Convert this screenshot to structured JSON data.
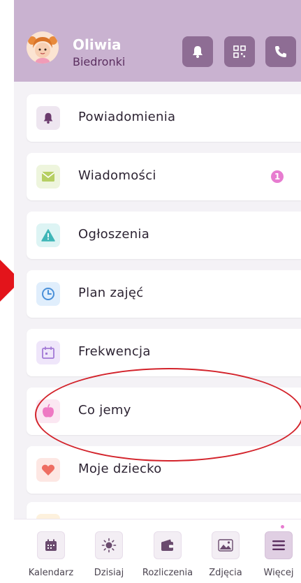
{
  "header": {
    "name": "Oliwia",
    "group": "Biedronki"
  },
  "menu": {
    "items": [
      {
        "label": "Powiadomienia",
        "icon": "bell-icon",
        "bg": "#eee6f0",
        "fg": "#6b3b6d"
      },
      {
        "label": "Wiadomości",
        "icon": "envelope-icon",
        "bg": "#eef5dd",
        "fg": "#b6cf63",
        "badge": "1"
      },
      {
        "label": "Ogłoszenia",
        "icon": "warning-icon",
        "bg": "#ddf4f4",
        "fg": "#3fb6b7"
      },
      {
        "label": "Plan zajęć",
        "icon": "clock-icon",
        "bg": "#e0eefc",
        "fg": "#4a90d9"
      },
      {
        "label": "Frekwencja",
        "icon": "calendar-icon",
        "bg": "#efe6fa",
        "fg": "#a27ad6"
      },
      {
        "label": "Co jemy",
        "icon": "apple-icon",
        "bg": "#fbe7f2",
        "fg": "#ee79c3"
      },
      {
        "label": "Moje dziecko",
        "icon": "heart-icon",
        "bg": "#fde7e3",
        "fg": "#ee6e62"
      }
    ]
  },
  "tabbar": {
    "tabs": [
      {
        "label": "Kalendarz",
        "icon": "calendar-grid-icon"
      },
      {
        "label": "Dzisiaj",
        "icon": "sun-icon"
      },
      {
        "label": "Rozliczenia",
        "icon": "wallet-icon"
      },
      {
        "label": "Zdjęcia",
        "icon": "image-icon"
      },
      {
        "label": "Więcej",
        "icon": "menu-icon",
        "active": true
      }
    ]
  }
}
